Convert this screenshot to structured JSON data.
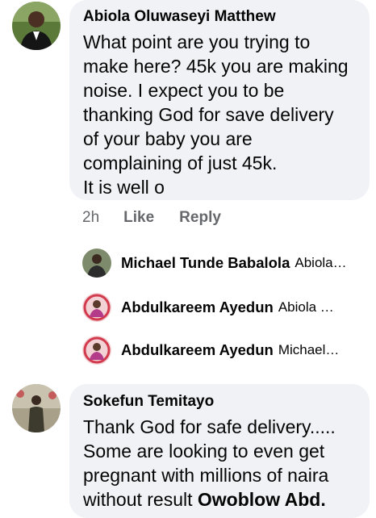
{
  "comments": [
    {
      "author": "Abiola Oluwaseyi Matthew",
      "lines": [
        "What point are you trying to",
        "make here? 45k you are making",
        "noise. I expect you to be",
        "thanking God for save delivery",
        "of your baby you are",
        "complaining of just 45k.",
        "It is well o"
      ],
      "time": "2h",
      "like_label": "Like",
      "reply_label": "Reply"
    },
    {
      "author": "Sokefun Temitayo",
      "lines": [
        "Thank God for safe delivery.....",
        "Some are looking to even get",
        "pregnant with millions of naira"
      ],
      "last_line_text": "without result ",
      "mention": "Owoblow Abd."
    }
  ],
  "replies": [
    {
      "name": "Michael Tunde Babalola",
      "preview": "Abiola…"
    },
    {
      "name": "Abdulkareem Ayedun",
      "preview": "Abiola Ol…"
    },
    {
      "name": "Abdulkareem Ayedun",
      "preview": "Michael …"
    }
  ],
  "colors": {
    "bubble": "#f0f2f5",
    "meta_gray": "#65676b",
    "text": "#050505"
  }
}
